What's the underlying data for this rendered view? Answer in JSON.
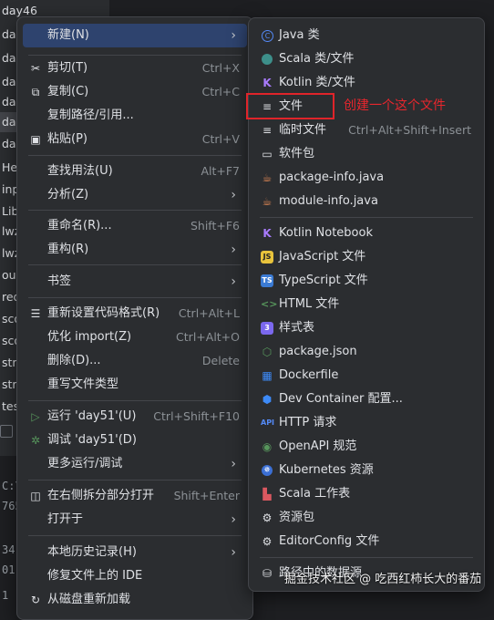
{
  "tree": {
    "rows": [
      "day46",
      "da",
      "da",
      "da",
      "da",
      "da",
      "da",
      "He",
      "inp",
      "Lib",
      "lwz",
      "lwz",
      "ou",
      "req",
      "sco",
      "sco",
      "str",
      "str",
      "tes"
    ]
  },
  "bg_lines": [
    "C:\\",
    "765",
    "34",
    "01",
    "1"
  ],
  "main_menu": [
    {
      "label": "新建(N)",
      "shortcut": "",
      "arrow": true,
      "icon": "",
      "highlight": true
    },
    {
      "label": "剪切(T)",
      "shortcut": "Ctrl+X",
      "icon": "scissors-icon"
    },
    {
      "label": "复制(C)",
      "shortcut": "Ctrl+C",
      "icon": "copy-icon"
    },
    {
      "label": "复制路径/引用...",
      "shortcut": "",
      "icon": ""
    },
    {
      "label": "粘贴(P)",
      "shortcut": "Ctrl+V",
      "icon": "paste-icon"
    },
    {
      "label": "查找用法(U)",
      "shortcut": "Alt+F7",
      "icon": ""
    },
    {
      "label": "分析(Z)",
      "shortcut": "",
      "arrow": true,
      "icon": ""
    },
    {
      "label": "重命名(R)...",
      "shortcut": "Shift+F6",
      "icon": ""
    },
    {
      "label": "重构(R)",
      "shortcut": "",
      "arrow": true,
      "icon": ""
    },
    {
      "label": "书签",
      "shortcut": "",
      "arrow": true,
      "icon": ""
    },
    {
      "label": "重新设置代码格式(R)",
      "shortcut": "Ctrl+Alt+L",
      "icon": "format-icon"
    },
    {
      "label": "优化 import(Z)",
      "shortcut": "Ctrl+Alt+O",
      "icon": ""
    },
    {
      "label": "删除(D)...",
      "shortcut": "Delete",
      "icon": ""
    },
    {
      "label": "重写文件类型",
      "shortcut": "",
      "icon": ""
    },
    {
      "label": "运行 'day51'(U)",
      "shortcut": "Ctrl+Shift+F10",
      "icon": "run-icon"
    },
    {
      "label": "调试 'day51'(D)",
      "shortcut": "",
      "icon": "debug-icon"
    },
    {
      "label": "更多运行/调试",
      "shortcut": "",
      "arrow": true,
      "icon": ""
    },
    {
      "label": "在右侧拆分部分打开",
      "shortcut": "Shift+Enter",
      "icon": "split-icon"
    },
    {
      "label": "打开于",
      "shortcut": "",
      "arrow": true,
      "icon": ""
    },
    {
      "label": "本地历史记录(H)",
      "shortcut": "",
      "arrow": true,
      "icon": ""
    },
    {
      "label": "修复文件上的 IDE",
      "shortcut": "",
      "icon": ""
    },
    {
      "label": "从磁盘重新加载",
      "shortcut": "",
      "icon": "reload-icon"
    }
  ],
  "sub_menu": [
    {
      "label": "Java 类",
      "shortcut": "",
      "icon": "java-class-icon"
    },
    {
      "label": "Scala 类/文件",
      "shortcut": "",
      "icon": "scala-class-icon"
    },
    {
      "label": "Kotlin 类/文件",
      "shortcut": "",
      "icon": "kotlin-icon"
    },
    {
      "label": "文件",
      "shortcut": "",
      "icon": "file-icon"
    },
    {
      "label": "临时文件",
      "shortcut": "Ctrl+Alt+Shift+Insert",
      "icon": "scratch-file-icon"
    },
    {
      "label": "软件包",
      "shortcut": "",
      "icon": "package-icon"
    },
    {
      "label": "package-info.java",
      "shortcut": "",
      "icon": "package-info-icon"
    },
    {
      "label": "module-info.java",
      "shortcut": "",
      "icon": "module-info-icon"
    },
    {
      "label": "Kotlin Notebook",
      "shortcut": "",
      "icon": "kotlin-notebook-icon"
    },
    {
      "label": "JavaScript 文件",
      "shortcut": "",
      "icon": "javascript-icon"
    },
    {
      "label": "TypeScript 文件",
      "shortcut": "",
      "icon": "typescript-icon"
    },
    {
      "label": "HTML 文件",
      "shortcut": "",
      "icon": "html-icon"
    },
    {
      "label": "样式表",
      "shortcut": "",
      "icon": "stylesheet-icon"
    },
    {
      "label": "package.json",
      "shortcut": "",
      "icon": "nodejs-icon"
    },
    {
      "label": "Dockerfile",
      "shortcut": "",
      "icon": "docker-icon"
    },
    {
      "label": "Dev Container 配置...",
      "shortcut": "",
      "icon": "dev-container-icon"
    },
    {
      "label": "HTTP 请求",
      "shortcut": "",
      "icon": "api-icon"
    },
    {
      "label": "OpenAPI 规范",
      "shortcut": "",
      "icon": "openapi-icon"
    },
    {
      "label": "Kubernetes 资源",
      "shortcut": "",
      "icon": "kubernetes-icon"
    },
    {
      "label": "Scala 工作表",
      "shortcut": "",
      "icon": "scala-worksheet-icon"
    },
    {
      "label": "资源包",
      "shortcut": "",
      "icon": "resource-bundle-icon"
    },
    {
      "label": "EditorConfig 文件",
      "shortcut": "",
      "icon": "gear-icon"
    },
    {
      "label": "路径中的数据源",
      "shortcut": "",
      "icon": "datasource-icon"
    }
  ],
  "annotation": {
    "text": "创建一个这个文件",
    "color": "#e0242a"
  },
  "watermark": "掘金技术社区 @ 吃西红柿长大的番茄",
  "colors": {
    "highlight": "#2e436e",
    "menu_bg": "#2b2d30",
    "separator": "#43454a"
  }
}
